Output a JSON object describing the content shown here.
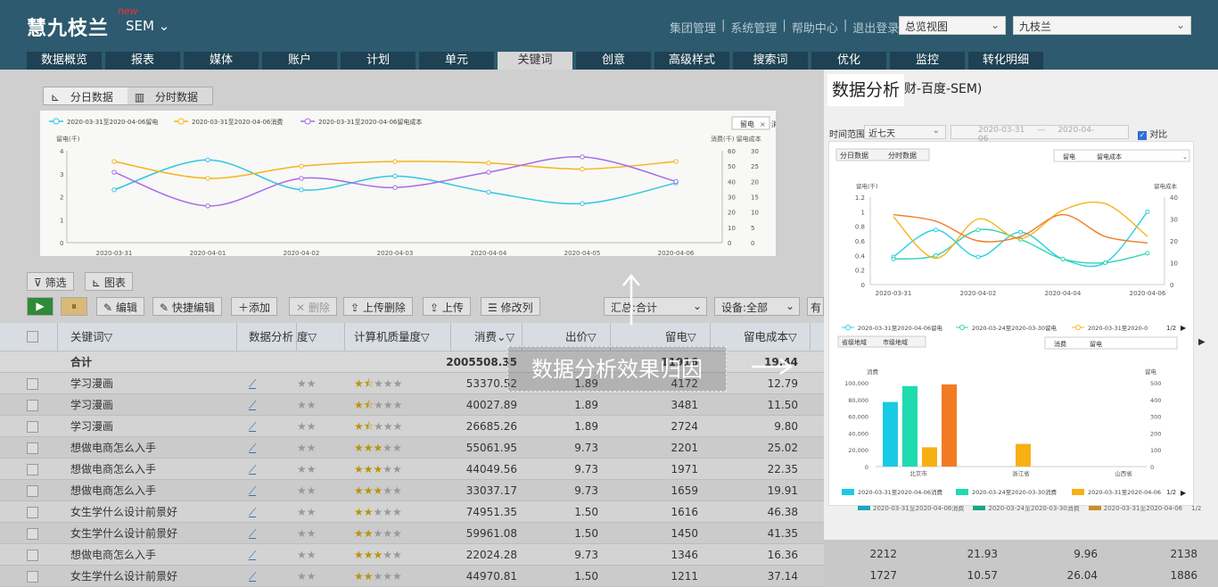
{
  "header": {
    "logo": "慧九枝兰",
    "new_tag": "new",
    "product": "SEM ⌄",
    "links": [
      "集团管理",
      "|",
      "系统管理",
      "|",
      "帮助中心",
      "|",
      "退出登录"
    ],
    "view_select": "总览视图",
    "account_select": "九枝兰"
  },
  "tabs": [
    "数据概览",
    "报表",
    "媒体",
    "账户",
    "计划",
    "单元",
    "关键词",
    "创意",
    "高级样式",
    "搜索词",
    "优化",
    "监控",
    "转化明细"
  ],
  "active_tab": "关键词",
  "chart_toggle": {
    "daily": "分日数据",
    "hourly": "分时数据"
  },
  "chart1": {
    "legend": [
      "2020-03-31至2020-04-06留电",
      "2020-03-31至2020-04-06消费",
      "2020-03-31至2020-04-06留电成本"
    ],
    "left_axis_label": "留电(千)",
    "right_axis_label": "消费(千) 留电成本",
    "filter_tag": "留电",
    "filter_tag2": "消费",
    "x": [
      "2020-03-31",
      "2020-04-01",
      "2020-04-02",
      "2020-04-03",
      "2020-04-04",
      "2020-04-05",
      "2020-04-06"
    ],
    "left_ticks": [
      "4",
      "3",
      "2",
      "1",
      "0"
    ],
    "right_ticks1": [
      "60",
      "50",
      "40",
      "30",
      "20",
      "10",
      "0"
    ],
    "right_ticks2": [
      "30",
      "25",
      "20",
      "15",
      "10",
      "5",
      "0"
    ]
  },
  "toolbar": {
    "filter": "筛选",
    "chart": "图表",
    "edit": "编辑",
    "quick_edit": "快捷编辑",
    "add": "添加",
    "delete": "删除",
    "upload_delete": "上传删除",
    "upload": "上传",
    "modify_col": "修改列",
    "summary": "汇总:合计",
    "device": "设备:全部",
    "more": "有"
  },
  "table": {
    "headers": [
      "关键词",
      "数据分析",
      "度",
      "计算机质量度",
      "消费",
      "出价",
      "留电",
      "留电成本"
    ],
    "total": {
      "label": "合计",
      "cost": "2005508.35",
      "lead": "11916",
      "lead_cost": "19.44"
    },
    "rows": [
      {
        "kw": "学习漫画",
        "stars": 1.5,
        "cost": "53370.52",
        "bid": "1.89",
        "lead": "4172",
        "lc": "12.79"
      },
      {
        "kw": "学习漫画",
        "stars": 1.5,
        "cost": "40027.89",
        "bid": "1.89",
        "lead": "3481",
        "lc": "11.50"
      },
      {
        "kw": "学习漫画",
        "stars": 1.5,
        "cost": "26685.26",
        "bid": "1.89",
        "lead": "2724",
        "lc": "9.80"
      },
      {
        "kw": "想做电商怎么入手",
        "stars": 3,
        "cost": "55061.95",
        "bid": "9.73",
        "lead": "2201",
        "lc": "25.02"
      },
      {
        "kw": "想做电商怎么入手",
        "stars": 3,
        "cost": "44049.56",
        "bid": "9.73",
        "lead": "1971",
        "lc": "22.35"
      },
      {
        "kw": "想做电商怎么入手",
        "stars": 3,
        "cost": "33037.17",
        "bid": "9.73",
        "lead": "1659",
        "lc": "19.91"
      },
      {
        "kw": "女生学什么设计前景好",
        "stars": 2,
        "cost": "74951.35",
        "bid": "1.50",
        "lead": "1616",
        "lc": "46.38"
      },
      {
        "kw": "女生学什么设计前景好",
        "stars": 2,
        "cost": "59961.08",
        "bid": "1.50",
        "lead": "1450",
        "lc": "41.35"
      },
      {
        "kw": "想做电商怎么入手",
        "stars": 3,
        "cost": "22024.28",
        "bid": "9.73",
        "lead": "1346",
        "lc": "16.36",
        "x1": "2212",
        "x2": "21.93",
        "x3": "9.96",
        "x4": "2138"
      },
      {
        "kw": "女生学什么设计前景好",
        "stars": 2,
        "cost": "44970.81",
        "bid": "1.50",
        "lead": "1211",
        "lc": "37.14",
        "x1": "1727",
        "x2": "10.57",
        "x3": "26.04",
        "x4": "1886"
      }
    ]
  },
  "overlay": {
    "label": "数据分析效果归因",
    "arrow": "⟶"
  },
  "right_panel": {
    "title": "数据分析",
    "title_rest": "财-百度-SEM)",
    "time_range_label": "时间范围:",
    "time_range": "近七天",
    "date1": "2020-03-31",
    "date2": "2020-04-06",
    "compare": "对比",
    "card": {
      "toggle": [
        "分日数据",
        "分时数据"
      ],
      "tags": [
        "留电",
        "留电成本"
      ],
      "line_left_label": "留电(千)",
      "line_right_label": "留电成本",
      "line_x": [
        "2020-03-31",
        "2020-04-02",
        "2020-04-04",
        "2020-04-06"
      ],
      "line_left_ticks": [
        "1.2",
        "1",
        "0.8",
        "0.6",
        "0.4",
        "0.2",
        "0"
      ],
      "line_right_ticks": [
        "40",
        "30",
        "20",
        "10",
        "0"
      ],
      "legend1": [
        "2020-03-31至2020-04-06留电",
        "2020-03-24至2020-03-30留电",
        "2020-03-31至2020-0"
      ],
      "page": "1/2",
      "region_toggle": [
        "省级地域",
        "市级地域"
      ],
      "region_tags": [
        "消费",
        "留电"
      ],
      "bar_left_label": "消费",
      "bar_right_label": "留电",
      "bar_left_ticks": [
        "100,000",
        "80,000",
        "60,000",
        "40,000",
        "20,000",
        "0"
      ],
      "bar_right_ticks": [
        "500",
        "400",
        "300",
        "200",
        "100",
        "0"
      ],
      "bar_categories": [
        "北京市",
        "浙江省",
        "山西省"
      ],
      "legend2": [
        "2020-03-31至2020-04-06消费",
        "2020-03-24至2020-03-30消费",
        "2020-03-31至2020-04-06"
      ]
    },
    "bottom_legend": [
      "2020-03-31至2020-04-06消费",
      "2020-03-24至2020-03-30消费",
      "2020-03-31至2020-04-06"
    ],
    "bottom_page": "1/2"
  },
  "chart_data": [
    {
      "type": "line",
      "x": [
        "2020-03-31",
        "2020-04-01",
        "2020-04-02",
        "2020-04-03",
        "2020-04-04",
        "2020-04-05",
        "2020-04-06"
      ],
      "series": [
        {
          "name": "2020-03-31至2020-04-06留电",
          "color": "#2ec7e0",
          "values": [
            2.3,
            3.6,
            2.3,
            2.9,
            2.2,
            1.7,
            2.6
          ]
        },
        {
          "name": "2020-03-31至2020-04-06消费",
          "color": "#f5b41c",
          "values": [
            53,
            42,
            50,
            53,
            52,
            48,
            53
          ]
        },
        {
          "name": "2020-03-31至2020-04-06留电成本",
          "color": "#a86ae8",
          "values": [
            23,
            12,
            21,
            18,
            23,
            28,
            20
          ]
        }
      ],
      "ylim_left": [
        0,
        4
      ],
      "ylim_right1": [
        0,
        60
      ],
      "ylim_right2": [
        0,
        30
      ]
    },
    {
      "type": "line",
      "x": [
        "2020-03-31",
        "2020-04-01",
        "2020-04-02",
        "2020-04-03",
        "2020-04-04",
        "2020-04-05",
        "2020-04-06"
      ],
      "series": [
        {
          "name": "2020-03-31至2020-04-06留电",
          "color": "#27d1e6",
          "values": [
            0.38,
            0.75,
            0.38,
            0.72,
            0.35,
            0.3,
            1.0
          ]
        },
        {
          "name": "2020-03-24至2020-03-30留电",
          "color": "#2fd6b3",
          "values": [
            0.35,
            0.4,
            0.75,
            0.62,
            0.35,
            0.3,
            0.43
          ]
        },
        {
          "name": "2020-03-31至2020-04-06留电成本",
          "color": "#f5b41c",
          "values": [
            31,
            12,
            30,
            21,
            34,
            37,
            22
          ]
        },
        {
          "color": "#f07d2a",
          "values": [
            32,
            29,
            20,
            22,
            32,
            22,
            19
          ]
        }
      ],
      "ylim_left": [
        0,
        1.2
      ],
      "ylim_right": [
        0,
        40
      ]
    },
    {
      "type": "bar",
      "categories": [
        "北京市",
        "浙江省",
        "山西省"
      ],
      "series": [
        {
          "name": "2020-03-31至2020-04-06消费",
          "color": "#18cbe4",
          "values": [
            77000,
            0,
            0
          ]
        },
        {
          "name": "2020-03-24至2020-03-30消费",
          "color": "#1fdbb0",
          "values": [
            96000,
            0,
            0
          ]
        },
        {
          "name": "2020-03-31至2020-04-06",
          "color": "#f7b014",
          "values": [
            23000,
            27000,
            0
          ]
        },
        {
          "color": "#f27b22",
          "values": [
            98000,
            0,
            0
          ]
        }
      ],
      "ylim": [
        0,
        100000
      ]
    }
  ]
}
